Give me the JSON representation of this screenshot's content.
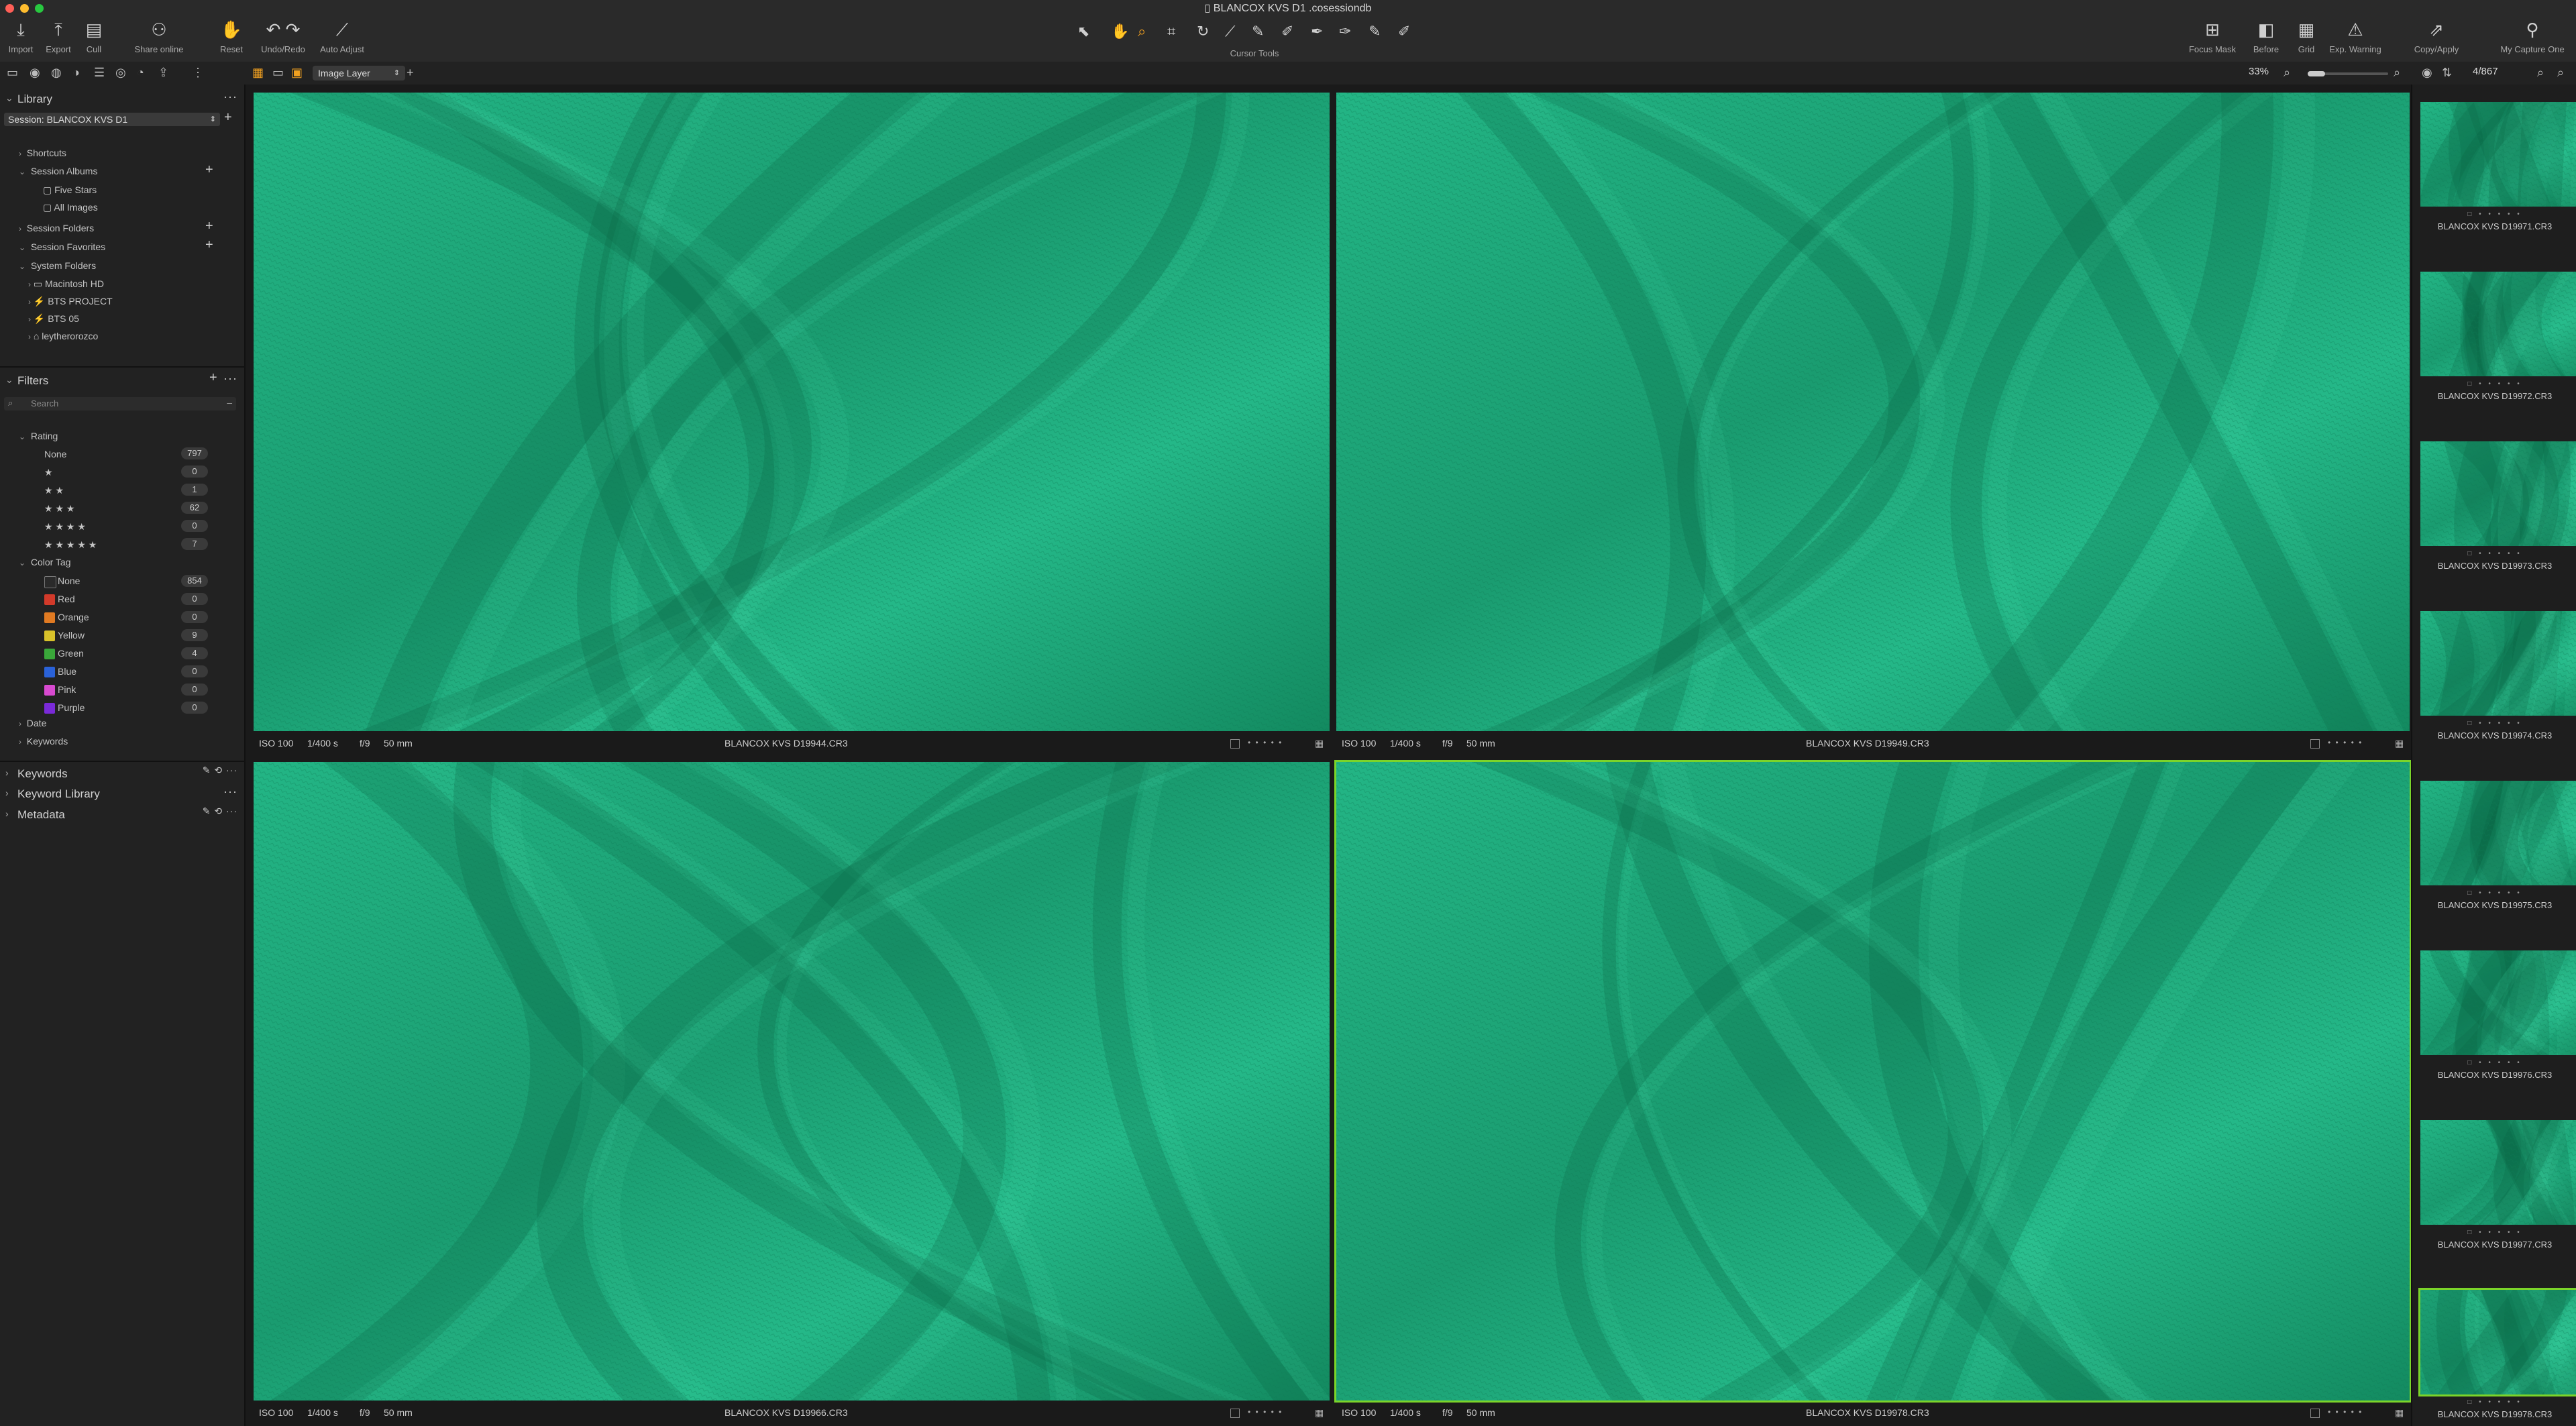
{
  "window": {
    "title": "BLANCOX KVS D1 .cosessiondb"
  },
  "toolbar": {
    "import": "Import",
    "export": "Export",
    "cull": "Cull",
    "share": "Share online",
    "reset": "Reset",
    "undo_redo": "Undo/Redo",
    "auto_adjust": "Auto Adjust",
    "cursor_tools": "Cursor Tools",
    "focus_mask": "Focus Mask",
    "before": "Before",
    "grid": "Grid",
    "exp_warning": "Exp. Warning",
    "copy_apply": "Copy/Apply",
    "my_capture_one": "My Capture One"
  },
  "subbar": {
    "layer": "Image Layer",
    "zoom": "33%",
    "counter": "4/867"
  },
  "library": {
    "title": "Library",
    "session": "Session: BLANCOX KVS D1",
    "shortcuts": "Shortcuts",
    "session_albums": "Session Albums",
    "albums": [
      "Five Stars",
      "All Images"
    ],
    "session_folders": "Session Folders",
    "session_favorites": "Session Favorites",
    "system_folders": "System Folders",
    "folders": [
      "Macintosh HD",
      "BTS PROJECT",
      "BTS 05",
      "leytherorozco"
    ]
  },
  "filters": {
    "title": "Filters",
    "search_placeholder": "Search",
    "rating_label": "Rating",
    "ratings": [
      {
        "label": "None",
        "count": "797"
      },
      {
        "label": "★",
        "count": "0"
      },
      {
        "label": "★ ★",
        "count": "1"
      },
      {
        "label": "★ ★ ★",
        "count": "62"
      },
      {
        "label": "★ ★ ★ ★",
        "count": "0"
      },
      {
        "label": "★ ★ ★ ★ ★",
        "count": "7"
      }
    ],
    "color_tag_label": "Color Tag",
    "colors": [
      {
        "label": "None",
        "count": "854",
        "color": "#2a2a2a"
      },
      {
        "label": "Red",
        "count": "0",
        "color": "#d23a2a"
      },
      {
        "label": "Orange",
        "count": "0",
        "color": "#e07a22"
      },
      {
        "label": "Yellow",
        "count": "9",
        "color": "#d8c22a"
      },
      {
        "label": "Green",
        "count": "4",
        "color": "#3aa83a"
      },
      {
        "label": "Blue",
        "count": "0",
        "color": "#2a62d8"
      },
      {
        "label": "Pink",
        "count": "0",
        "color": "#d84ad0"
      },
      {
        "label": "Purple",
        "count": "0",
        "color": "#7a2ad8"
      }
    ],
    "date": "Date",
    "keywords": "Keywords"
  },
  "panels": {
    "keywords": "Keywords",
    "keyword_library": "Keyword Library",
    "metadata": "Metadata"
  },
  "viewer": {
    "images": [
      {
        "iso": "ISO 100",
        "shutter": "1/400 s",
        "aperture": "f/9",
        "focal": "50 mm",
        "name": "BLANCOX KVS D19944.CR3",
        "dots": "• • • • •"
      },
      {
        "iso": "ISO 100",
        "shutter": "1/400 s",
        "aperture": "f/9",
        "focal": "50 mm",
        "name": "BLANCOX KVS D19949.CR3",
        "dots": "• • • • •"
      },
      {
        "iso": "ISO 100",
        "shutter": "1/400 s",
        "aperture": "f/9",
        "focal": "50 mm",
        "name": "BLANCOX KVS D19966.CR3",
        "dots": "• • • • •"
      },
      {
        "iso": "ISO 100",
        "shutter": "1/400 s",
        "aperture": "f/9",
        "focal": "50 mm",
        "name": "BLANCOX KVS D19978.CR3",
        "dots": "• • • • •"
      }
    ]
  },
  "filmstrip": [
    {
      "name": "BLANCOX KVS D19971.CR3"
    },
    {
      "name": "BLANCOX KVS D19972.CR3"
    },
    {
      "name": "BLANCOX KVS D19973.CR3"
    },
    {
      "name": "BLANCOX KVS D19974.CR3"
    },
    {
      "name": "BLANCOX KVS D19975.CR3"
    },
    {
      "name": "BLANCOX KVS D19976.CR3"
    },
    {
      "name": "BLANCOX KVS D19977.CR3"
    },
    {
      "name": "BLANCOX KVS D19978.CR3"
    }
  ],
  "colors": {
    "fabric": "#1fa77a",
    "fabric_dark": "#0d6b4c",
    "selection": "#7bd42a"
  }
}
